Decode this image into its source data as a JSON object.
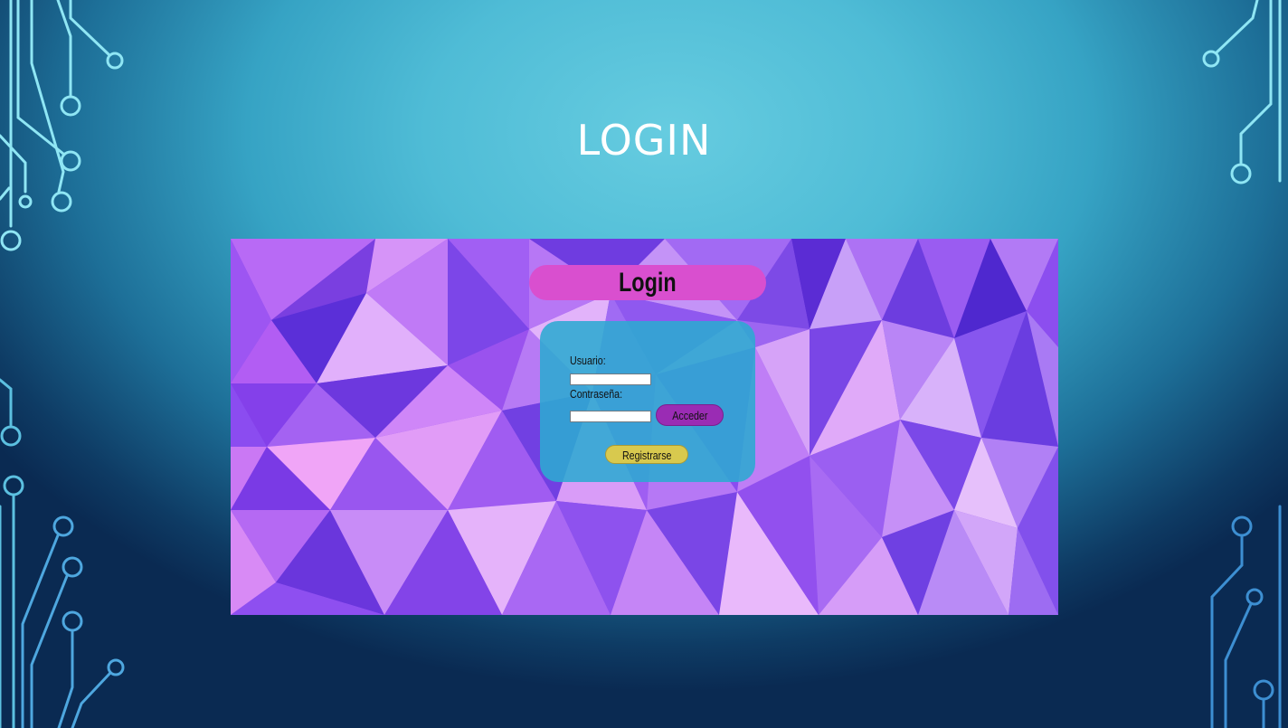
{
  "slide": {
    "title": "LOGIN"
  },
  "app": {
    "header": "Login",
    "form": {
      "username_label": "Usuario:",
      "username_value": "",
      "password_label": "Contraseña:",
      "password_value": "",
      "submit_label": "Acceder",
      "register_label": "Registrarse"
    }
  },
  "colors": {
    "header_pill": "#d94fcf",
    "form_panel": "#2caad2",
    "submit_button": "#9a2cb4",
    "register_button": "#d8c94e"
  }
}
